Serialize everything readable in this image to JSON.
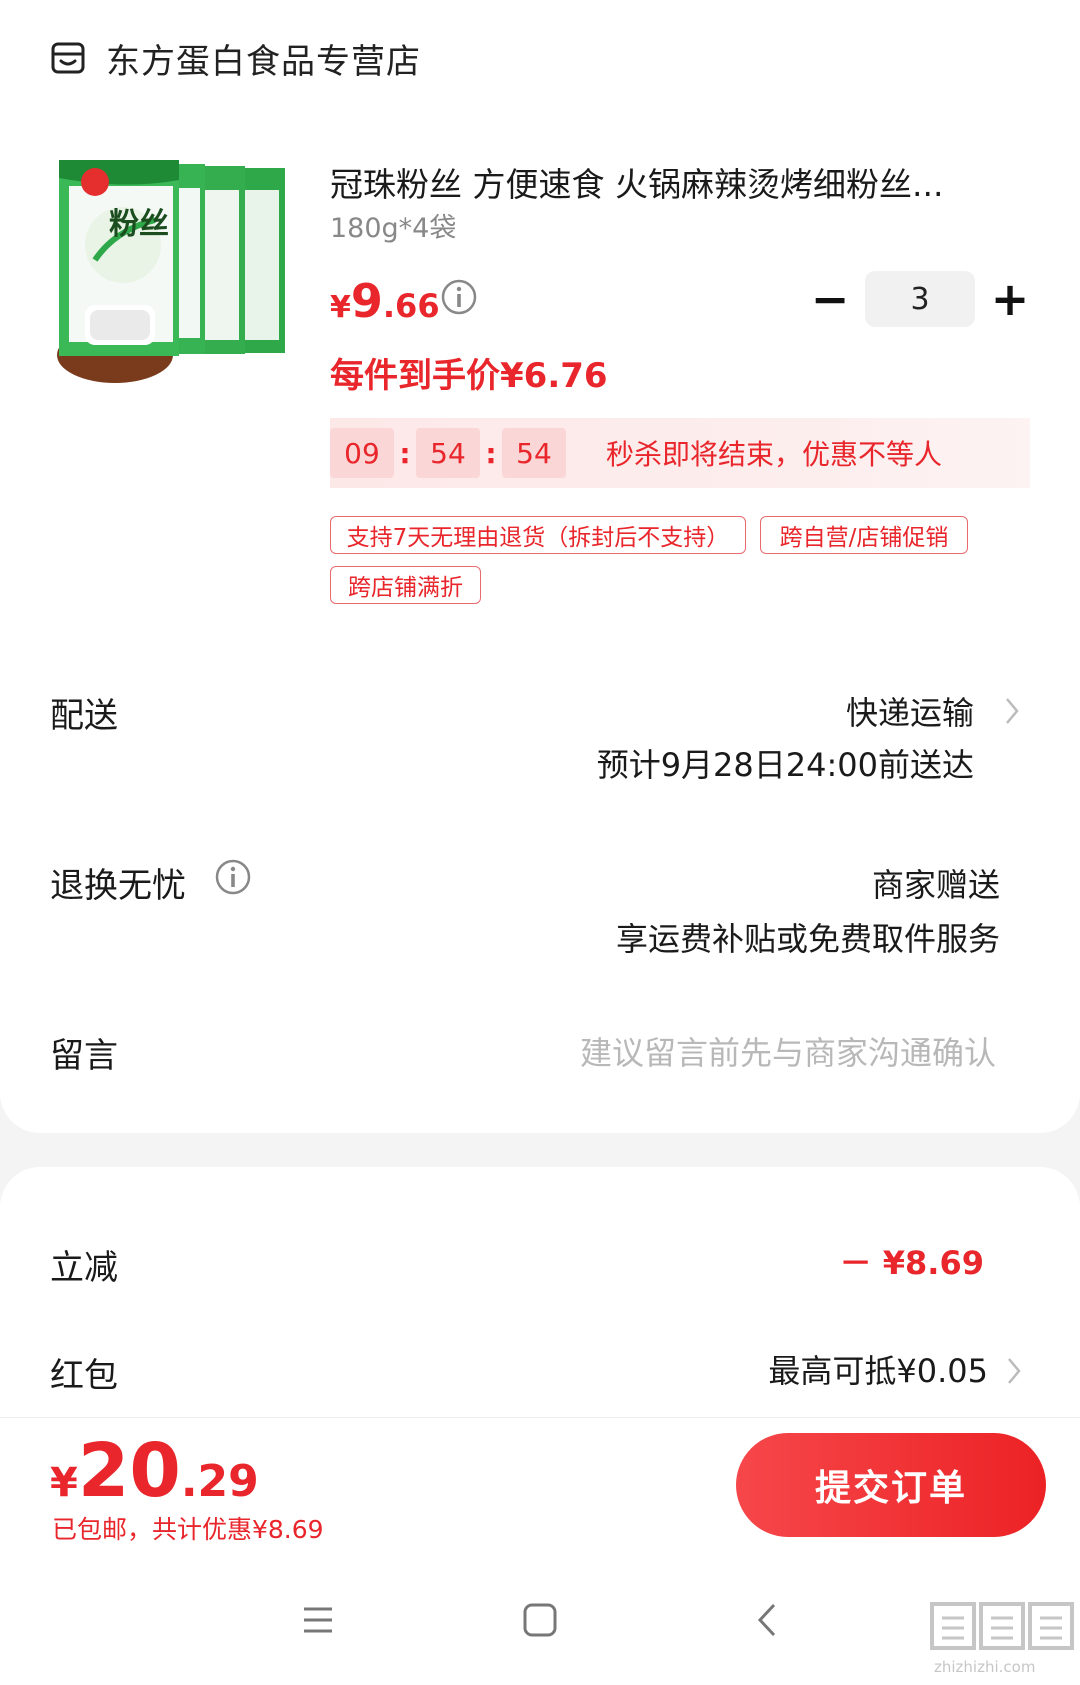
{
  "store": {
    "name": "东方蛋白食品专营店",
    "icon": "store-icon"
  },
  "product": {
    "title": "冠珠粉丝 方便速食 火锅麻辣烫烤细粉丝...",
    "spec": "180g*4袋",
    "price_symbol": "¥",
    "price_int": "9",
    "price_dec": ".66",
    "deal_price": "每件到手价¥6.76",
    "image_text": "粉丝"
  },
  "stepper": {
    "minus": "−",
    "value": "3",
    "plus": "+"
  },
  "countdown": {
    "hh": "09",
    "mm": "54",
    "ss": "54",
    "sep": ":",
    "text": "秒杀即将结束，优惠不等人"
  },
  "tags": [
    "支持7天无理由退货（拆封后不支持）",
    "跨自营/店铺促销",
    "跨店铺满折"
  ],
  "delivery": {
    "label": "配送",
    "method": "快递运输",
    "eta": "预计9月28日24:00前送达"
  },
  "returns": {
    "label": "退换无忧",
    "line1": "商家赠送",
    "line2": "享运费补贴或免费取件服务"
  },
  "message": {
    "label": "留言",
    "placeholder": "建议留言前先与商家沟通确认"
  },
  "discount": {
    "label": "立减",
    "value": "－ ¥8.69"
  },
  "redpacket": {
    "label": "红包",
    "value": "最高可抵¥0.05"
  },
  "total": {
    "symbol": "¥",
    "int": "20",
    "dec": ".29",
    "note": "已包邮，共计优惠¥8.69"
  },
  "submit": {
    "label": "提交订单"
  },
  "nav": [
    "menu-icon",
    "home-icon",
    "back-icon"
  ],
  "watermark": {
    "text": "值值值",
    "url": "zhizhizhi.com"
  },
  "colors": {
    "accent": "#e8262b",
    "bg": "#f4f4f4"
  }
}
